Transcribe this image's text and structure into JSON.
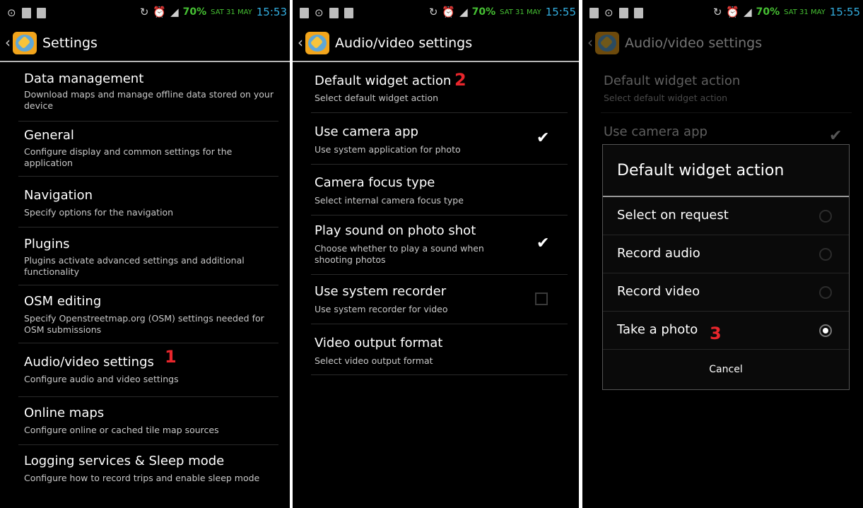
{
  "status": {
    "battery": "70%",
    "date": "SAT 31 MAY",
    "time_p1": "15:53",
    "time_p2": "15:55",
    "time_p3": "15:55"
  },
  "panel1": {
    "title": "Settings",
    "items": [
      {
        "title": "Data management",
        "summary": "Download maps and manage offline data stored on your device"
      },
      {
        "title": "General",
        "summary": "Configure display and common settings for the application"
      },
      {
        "title": "Navigation",
        "summary": "Specify options for the navigation"
      },
      {
        "title": "Plugins",
        "summary": "Plugins activate advanced settings and additional functionality"
      },
      {
        "title": "OSM editing",
        "summary": "Specify Openstreetmap.org (OSM) settings needed for OSM submissions"
      },
      {
        "title": "Audio/video settings",
        "summary": "Configure audio and video settings"
      },
      {
        "title": "Online maps",
        "summary": "Configure online or cached tile map sources"
      },
      {
        "title": "Logging services & Sleep mode",
        "summary": "Configure how to record trips and enable sleep mode"
      }
    ],
    "step": "1"
  },
  "panel2": {
    "title": "Audio/video settings",
    "items": [
      {
        "title": "Default widget action",
        "summary": "Select default widget action"
      },
      {
        "title": "Use camera app",
        "summary": "Use system application for photo",
        "checked": true
      },
      {
        "title": "Camera focus type",
        "summary": "Select internal camera focus type"
      },
      {
        "title": "Play sound on photo shot",
        "summary": "Choose whether to play a sound when shooting photos",
        "checked": true
      },
      {
        "title": "Use system recorder",
        "summary": "Use system recorder for video",
        "checked": false
      },
      {
        "title": "Video output format",
        "summary": "Select video output format"
      }
    ],
    "step": "2"
  },
  "panel3": {
    "title": "Audio/video settings",
    "bg_items": [
      {
        "title": "Default widget action",
        "summary": "Select default widget action"
      },
      {
        "title": "Use camera app"
      }
    ],
    "dialog": {
      "title": "Default widget action",
      "options": [
        {
          "label": "Select on request",
          "selected": false
        },
        {
          "label": "Record audio",
          "selected": false
        },
        {
          "label": "Record video",
          "selected": false
        },
        {
          "label": "Take a photo",
          "selected": true
        }
      ],
      "cancel": "Cancel"
    },
    "step": "3"
  },
  "icons": {
    "checkmark": "✔",
    "back": "‹"
  },
  "colors": {
    "battery": "#46c033",
    "clock": "#33aee0",
    "step_number": "#e8262c"
  }
}
